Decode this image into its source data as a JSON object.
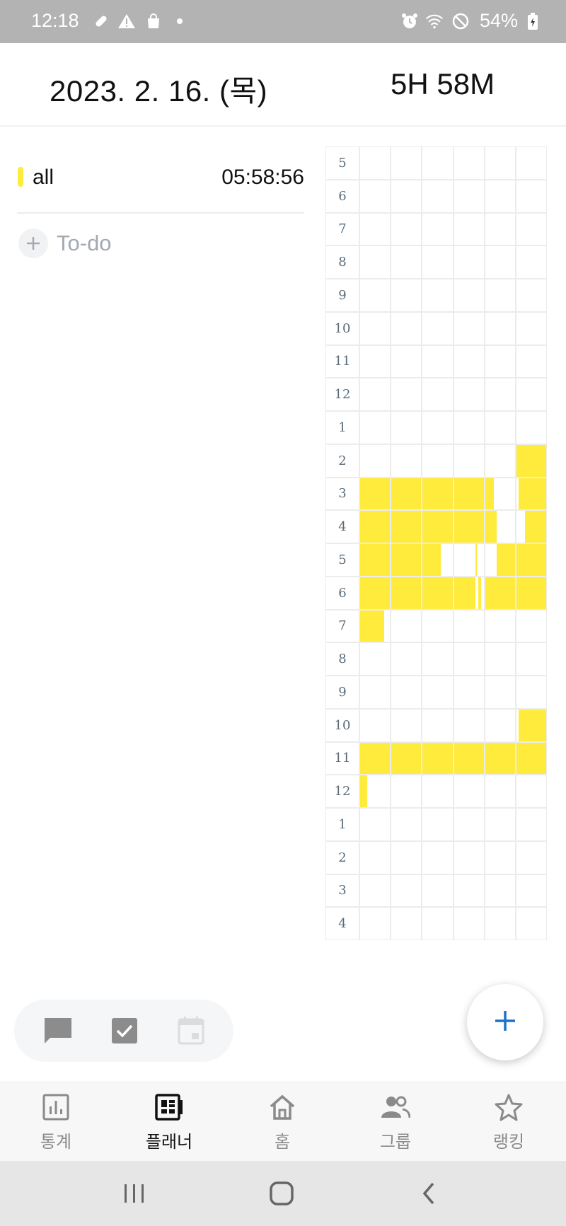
{
  "status_bar": {
    "time": "12:18",
    "battery": "54%",
    "icons": [
      "bandage-icon",
      "warning-icon",
      "shopping-bag-icon",
      "dot-icon",
      "alarm-icon",
      "wifi-icon",
      "do-not-disturb-icon",
      "battery-icon"
    ]
  },
  "header": {
    "date": "2023. 2. 16. (목)",
    "total_time": "5H 58M"
  },
  "subjects": [
    {
      "name": "all",
      "time": "05:58:56",
      "color": "#ffeb3b"
    }
  ],
  "todo": {
    "add_label": "To-do"
  },
  "timetable": {
    "hours": [
      "5",
      "6",
      "7",
      "8",
      "9",
      "10",
      "11",
      "12",
      "1",
      "2",
      "3",
      "4",
      "5",
      "6",
      "7",
      "8",
      "9",
      "10",
      "11",
      "12",
      "1",
      "2",
      "3",
      "4"
    ],
    "fill_color": "#ffeb3b",
    "study_segments": [
      {
        "row": 9,
        "start_min": 50,
        "end_min": 60
      },
      {
        "row": 10,
        "start_min": 0,
        "end_min": 43
      },
      {
        "row": 10,
        "start_min": 51,
        "end_min": 60
      },
      {
        "row": 11,
        "start_min": 0,
        "end_min": 44
      },
      {
        "row": 11,
        "start_min": 53,
        "end_min": 60
      },
      {
        "row": 12,
        "start_min": 0,
        "end_min": 26
      },
      {
        "row": 12,
        "start_min": 37,
        "end_min": 37.5
      },
      {
        "row": 12,
        "start_min": 44,
        "end_min": 60
      },
      {
        "row": 13,
        "start_min": 0,
        "end_min": 37
      },
      {
        "row": 13,
        "start_min": 38,
        "end_min": 39
      },
      {
        "row": 13,
        "start_min": 40,
        "end_min": 60
      },
      {
        "row": 14,
        "start_min": 0,
        "end_min": 8
      },
      {
        "row": 17,
        "start_min": 51,
        "end_min": 60
      },
      {
        "row": 18,
        "start_min": 0,
        "end_min": 60
      },
      {
        "row": 19,
        "start_min": 0,
        "end_min": 2.5
      }
    ]
  },
  "mode_buttons": [
    {
      "name": "comment",
      "icon": "comment-icon"
    },
    {
      "name": "checklist",
      "icon": "checkbox-icon"
    },
    {
      "name": "calendar",
      "icon": "calendar-icon"
    }
  ],
  "fab": {
    "icon": "plus-icon",
    "color": "#1a73c9"
  },
  "bottom_nav": [
    {
      "label": "통계",
      "icon": "stats-icon",
      "active": false
    },
    {
      "label": "플래너",
      "icon": "planner-icon",
      "active": true
    },
    {
      "label": "홈",
      "icon": "home-icon",
      "active": false
    },
    {
      "label": "그룹",
      "icon": "group-icon",
      "active": false
    },
    {
      "label": "랭킹",
      "icon": "star-icon",
      "active": false
    }
  ]
}
